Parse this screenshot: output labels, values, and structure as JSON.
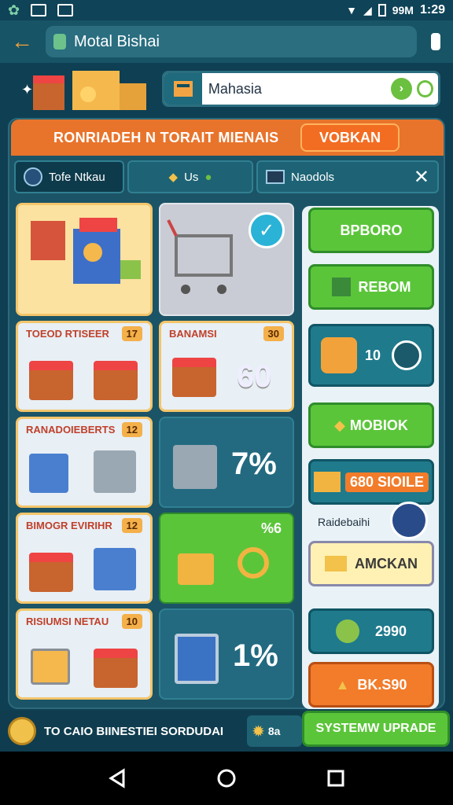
{
  "status": {
    "time": "1:29",
    "extra": "99M"
  },
  "appbar": {
    "title": "Motal Bishai"
  },
  "search": {
    "value": "Mahasia"
  },
  "banner": {
    "title": "RONRIADEH N TORAIT MIENAIS",
    "button": "VOBKAN"
  },
  "tabs": [
    {
      "label": "Tofe Ntkau"
    },
    {
      "label": "Us"
    },
    {
      "label": "Naodols"
    }
  ],
  "cards": [
    {
      "title": "",
      "badge": ""
    },
    {
      "title": "TOEOD RTISEER",
      "badge": "17"
    },
    {
      "title": "BANAMSI",
      "badge": "30"
    },
    {
      "title": "RANADOIEBERTS",
      "badge": "12"
    },
    {
      "title": "BIMOGR EVIRIHR",
      "badge": "12"
    },
    {
      "title": "RISIUMSI NETAU",
      "badge": "10"
    }
  ],
  "dark_tiles": [
    {
      "value": "60"
    },
    {
      "value": "7%"
    },
    {
      "value": "%6"
    },
    {
      "value": "1%"
    }
  ],
  "side": {
    "btn1": "BPBORO",
    "btn2": "REBOM",
    "coin_value": "10",
    "btn3": "MOBIOK",
    "btn4": "680 SIOILE",
    "caption": "Raidebaihi",
    "btn5": "AMCKAN",
    "price": "2990",
    "cta": "BK.S90"
  },
  "footer": {
    "text": "TO CAIO BIINESTIEI SORDUDAI",
    "mid": "8a",
    "action": "SYSTEMW UPRADE"
  },
  "colors": {
    "accent": "#e8742c",
    "panel": "#1b5466",
    "green": "#5bc53a"
  }
}
